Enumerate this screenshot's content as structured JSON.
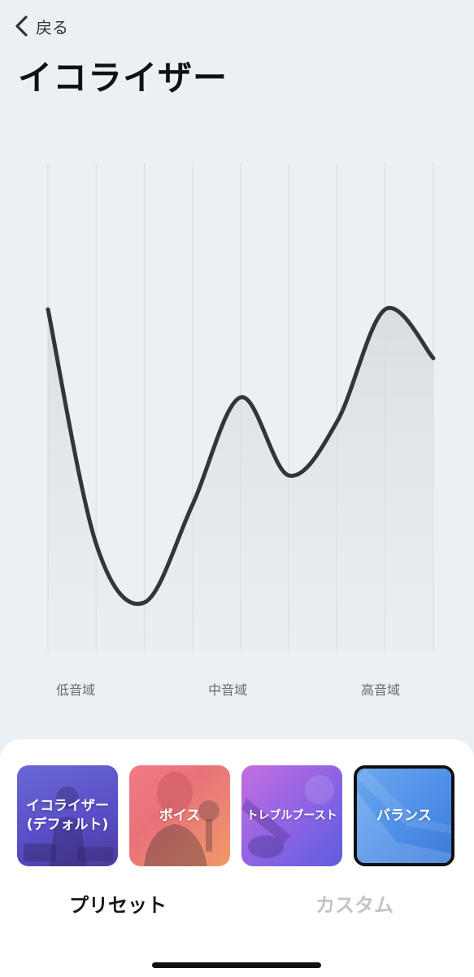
{
  "nav": {
    "back_label": "戻る"
  },
  "page": {
    "title": "イコライザー"
  },
  "equalizer": {
    "band_labels": {
      "low": "低音域",
      "mid": "中音域",
      "high": "高音域"
    },
    "levels": [
      0.7,
      0.22,
      0.1,
      0.3,
      0.52,
      0.36,
      0.47,
      0.7,
      0.6
    ],
    "colors": {
      "curve": "#34353b",
      "grid": "#d9dee3",
      "fill": "#dfe2e6"
    }
  },
  "presets": {
    "items": [
      {
        "label": "イコライザー\n(デフォルト)",
        "selected": false
      },
      {
        "label": "ボイス",
        "selected": false
      },
      {
        "label": "トレブルブースト",
        "selected": false
      },
      {
        "label": "バランス",
        "selected": true
      }
    ]
  },
  "tabs": {
    "preset": "プリセット",
    "custom": "カスタム",
    "active": "preset"
  }
}
